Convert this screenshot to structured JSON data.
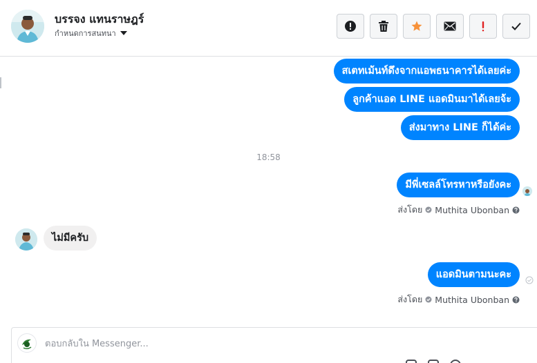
{
  "header": {
    "contact_name": "บรรจง แทนราษฎร์",
    "manage_label": "กำหนดการสนทนา",
    "tools": [
      {
        "name": "spam-report",
        "icon": "exclamation-circle-icon"
      },
      {
        "name": "delete",
        "icon": "trash-icon"
      },
      {
        "name": "star",
        "icon": "star-icon"
      },
      {
        "name": "mark-unread",
        "icon": "envelope-icon"
      },
      {
        "name": "follow-up",
        "icon": "exclamation-mark-icon"
      },
      {
        "name": "done",
        "icon": "checkmark-icon"
      }
    ]
  },
  "messages": {
    "out_1": "สเตทเม้นท์ดึงจากแอพธนาคารได้เลยค่ะ",
    "out_2": "ลูกค้าแอด LINE แอดมินมาได้เลยจ้ะ",
    "out_3": "ส่งมาทาง LINE ก็ได้ค่ะ",
    "timestamp": "18:58",
    "out_4": "มีพี่เซลล์โทรหาหรือยังคะ",
    "sent_by_1_prefix": "ส่งโดย",
    "sent_by_1_name": "Muthita Ubonban",
    "in_1": "ไม่มีครับ",
    "out_5": "แอดมินตามนะคะ",
    "sent_by_2_prefix": "ส่งโดย",
    "sent_by_2_name": "Muthita Ubonban"
  },
  "composer": {
    "placeholder": "ตอบกลับใน Messenger..."
  },
  "colors": {
    "outgoing_bubble": "#0084ff",
    "incoming_bubble": "#f1f0f0",
    "star": "#f7923a",
    "flag": "#e02020"
  }
}
